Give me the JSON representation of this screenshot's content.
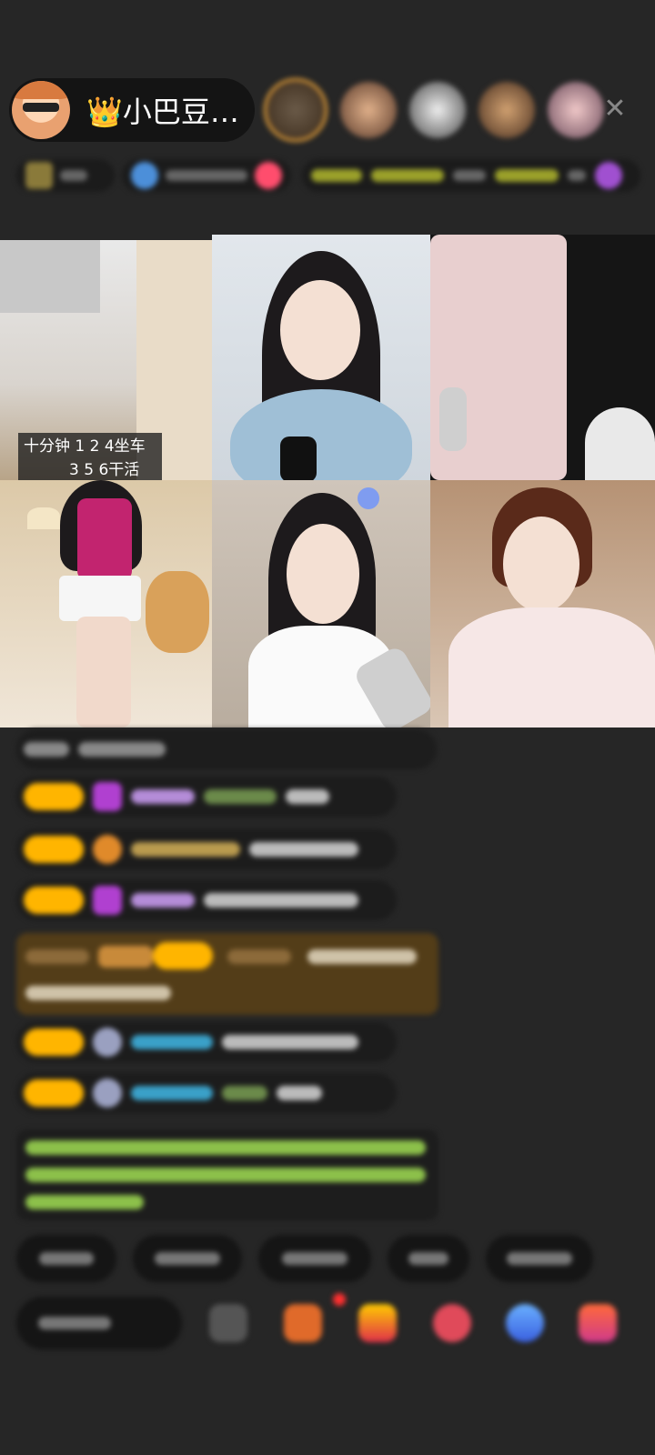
{
  "header": {
    "host_name": "👑小巴豆…",
    "close_label": "✕"
  },
  "video_grid": {
    "caption_line1": "十分钟 1 2 4坐车",
    "caption_line2": "3 5 6干活"
  },
  "colors": {
    "background": "#262626",
    "badge_yellow": "#ffb500",
    "gift_msg_bg": "#533d18",
    "system_text": "#8cc04a",
    "close_icon": "#888888"
  },
  "icons": [
    "host-avatar",
    "crown-icon",
    "close-icon",
    "diamond-icon",
    "gift-icon",
    "present-icon",
    "chat-icon",
    "share-icon",
    "more-icon"
  ]
}
